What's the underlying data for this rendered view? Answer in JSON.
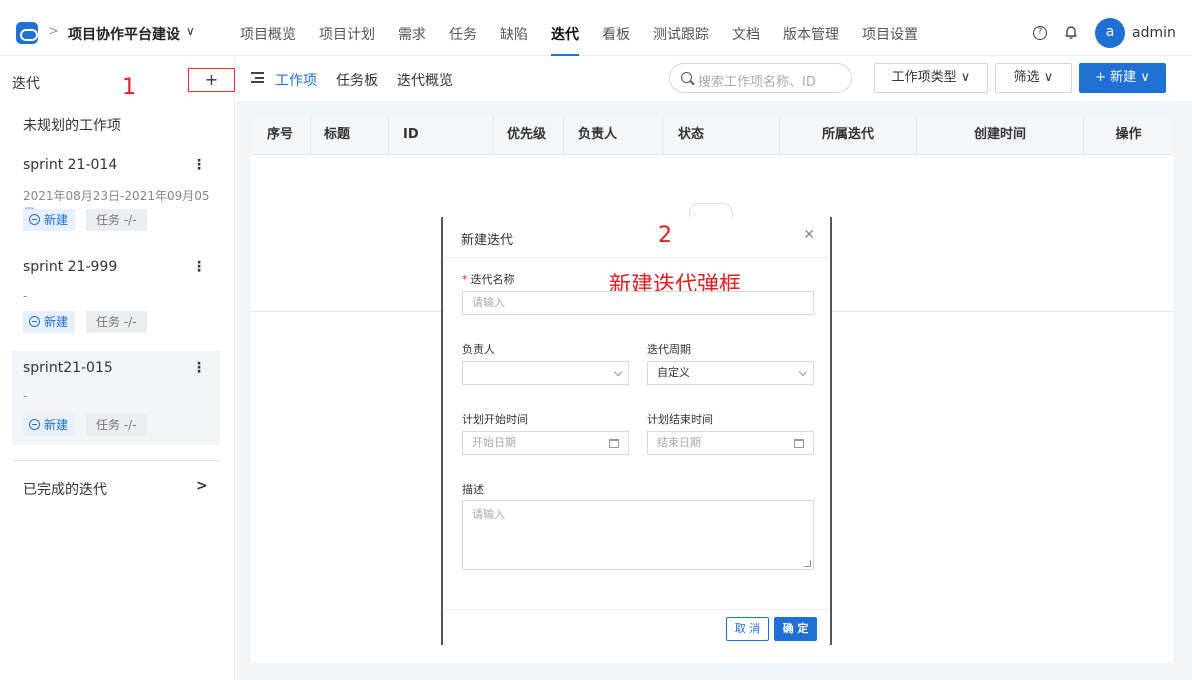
{
  "header": {
    "project_name": "项目协作平台建设",
    "nav": [
      "项目概览",
      "项目计划",
      "需求",
      "任务",
      "缺陷",
      "迭代",
      "看板",
      "测试跟踪",
      "文档",
      "版本管理",
      "项目设置"
    ],
    "active_nav": "迭代",
    "avatar_letter": "a",
    "username": "admin"
  },
  "sidebar": {
    "title": "迭代",
    "add_label": "+",
    "annotation": "1",
    "unplanned": "未规划的工作项",
    "sprints": [
      {
        "name": "sprint 21-014",
        "date": "2021年08月23日-2021年09月05日",
        "status": "新建",
        "task": "任务 -/-"
      },
      {
        "name": "sprint 21-999",
        "date": "-",
        "status": "新建",
        "task": "任务 -/-"
      },
      {
        "name": "sprint21-015",
        "date": "-",
        "status": "新建",
        "task": "任务 -/-"
      }
    ],
    "done": "已完成的迭代"
  },
  "toolbar": {
    "tabs": [
      "工作项",
      "任务板",
      "迭代概览"
    ],
    "search_placeholder": "搜索工作项名称、ID",
    "type_filter": "工作项类型 ∨",
    "filter": "筛选 ∨",
    "new_button": "+ 新建 ∨"
  },
  "table": {
    "columns": [
      "序号",
      "标题",
      "ID",
      "优先级",
      "负责人",
      "状态",
      "所属迭代",
      "创建时间",
      "操作"
    ]
  },
  "modal": {
    "title": "新建迭代",
    "annotation_number": "2",
    "annotation_text": "新建迭代弹框",
    "name_label": "迭代名称",
    "name_placeholder": "请输入",
    "owner_label": "负责人",
    "cycle_label": "迭代周期",
    "cycle_value": "自定义",
    "start_label": "计划开始时间",
    "start_placeholder": "开始日期",
    "end_label": "计划结束时间",
    "end_placeholder": "结束日期",
    "desc_label": "描述",
    "desc_placeholder": "请输入",
    "cancel": "取 消",
    "ok": "确 定"
  }
}
